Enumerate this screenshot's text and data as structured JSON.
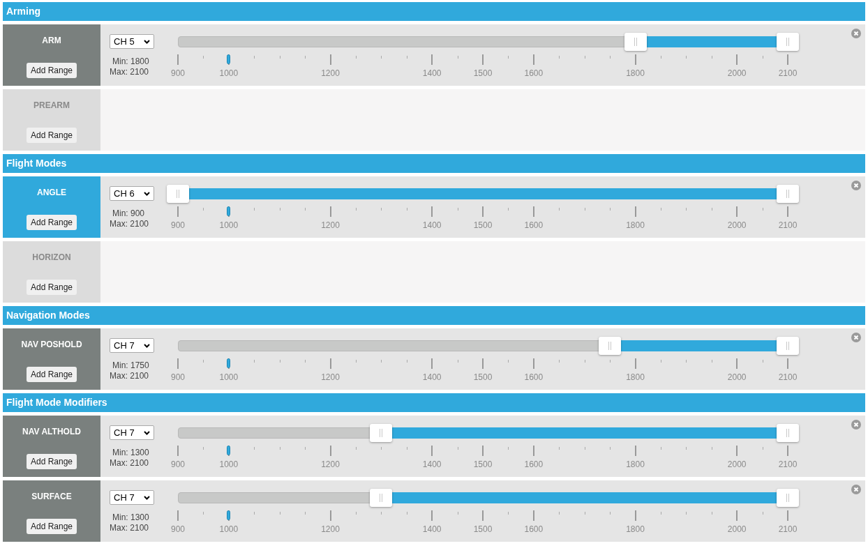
{
  "sections": [
    {
      "title": "Arming",
      "modes": [
        {
          "name": "ARM",
          "active": false,
          "button": "Add Range",
          "range": {
            "channel": "CH 5",
            "min": "Min: 1800",
            "max": "Max: 2100",
            "level": 0.0833,
            "scale": [
              "900",
              "1000",
              "1200",
              "1400",
              "1500",
              "1600",
              "1800",
              "2000",
              "2100"
            ]
          }
        },
        {
          "name": "PREARM",
          "active": false,
          "button": "Add Range"
        }
      ]
    },
    {
      "title": "Flight Modes",
      "modes": [
        {
          "name": "ANGLE",
          "active": true,
          "button": "Add Range",
          "range": {
            "channel": "CH 6",
            "min": "Min: 900",
            "max": "Max: 2100",
            "level": 0.0833,
            "scale": [
              "900",
              "1000",
              "1200",
              "1400",
              "1500",
              "1600",
              "1800",
              "2000",
              "2100"
            ]
          }
        },
        {
          "name": "HORIZON",
          "active": false,
          "button": "Add Range"
        }
      ]
    },
    {
      "title": "Navigation Modes",
      "modes": [
        {
          "name": "NAV POSHOLD",
          "active": false,
          "button": "Add Range",
          "range": {
            "channel": "CH 7",
            "min": "Min: 1750",
            "max": "Max: 2100",
            "level": 0.0833,
            "scale": [
              "900",
              "1000",
              "1200",
              "1400",
              "1500",
              "1600",
              "1800",
              "2000",
              "2100"
            ]
          }
        }
      ]
    },
    {
      "title": "Flight Mode Modifiers",
      "modes": [
        {
          "name": "NAV ALTHOLD",
          "active": false,
          "button": "Add Range",
          "range": {
            "channel": "CH 7",
            "min": "Min: 1300",
            "max": "Max: 2100",
            "level": 0.0833,
            "scale": [
              "900",
              "1000",
              "1200",
              "1400",
              "1500",
              "1600",
              "1800",
              "2000",
              "2100"
            ]
          }
        },
        {
          "name": "SURFACE",
          "active": false,
          "button": "Add Range",
          "range": {
            "channel": "CH 7",
            "min": "Min: 1300",
            "max": "Max: 2100",
            "level": 0.0833,
            "scale": [
              "900",
              "1000",
              "1200",
              "1400",
              "1500",
              "1600",
              "1800",
              "2000",
              "2100"
            ]
          }
        }
      ]
    }
  ]
}
